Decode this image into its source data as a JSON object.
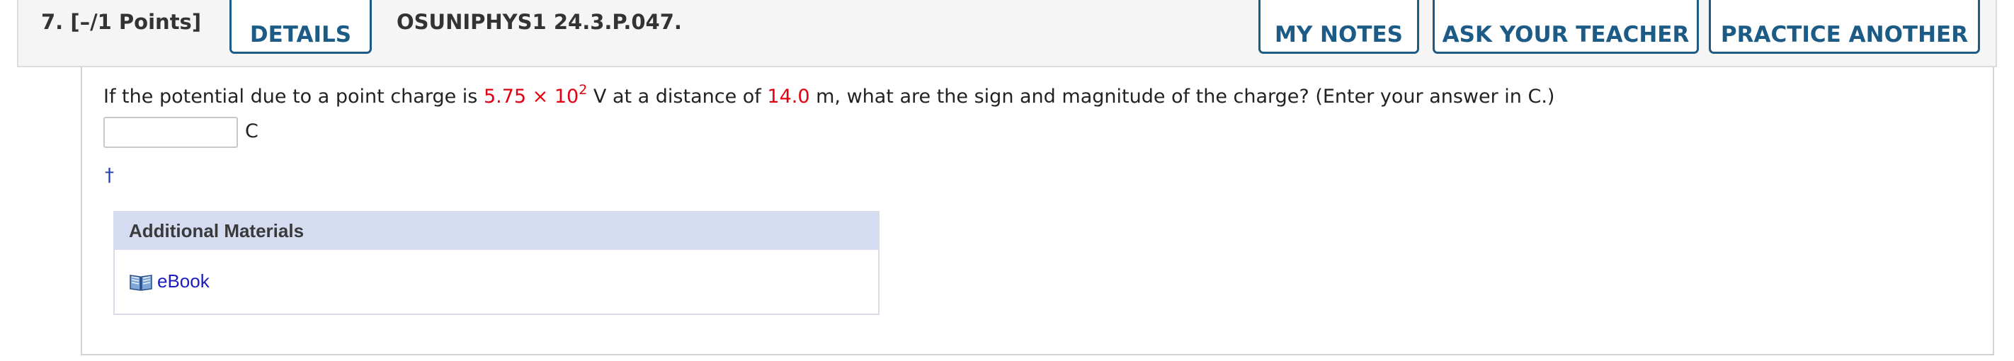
{
  "header": {
    "question_number": "7.",
    "points": "[–/1 Points]",
    "details_label": "DETAILS",
    "problem_code": "OSUNIPHYS1 24.3.P.047.",
    "my_notes_label": "MY NOTES",
    "ask_teacher_label": "ASK YOUR TEACHER",
    "practice_another_label": "PRACTICE ANOTHER"
  },
  "question": {
    "text_1": "If the potential due to a point charge is ",
    "value_mantissa": "5.75 × 10",
    "value_exponent": "2",
    "text_2": " V at a distance of ",
    "distance": "14.0",
    "text_3": " m, what are the sign and magnitude of the charge? (Enter your answer in C.)",
    "answer_value": "",
    "unit": "C",
    "footnote_marker": "†"
  },
  "materials": {
    "heading": "Additional Materials",
    "ebook_label": "eBook",
    "ebook_icon": "open-book-icon"
  },
  "colors": {
    "accent": "#1d5b87",
    "highlight": "#e3000f",
    "materials_header": "#d5dcf2",
    "link": "#1d1dbd"
  }
}
